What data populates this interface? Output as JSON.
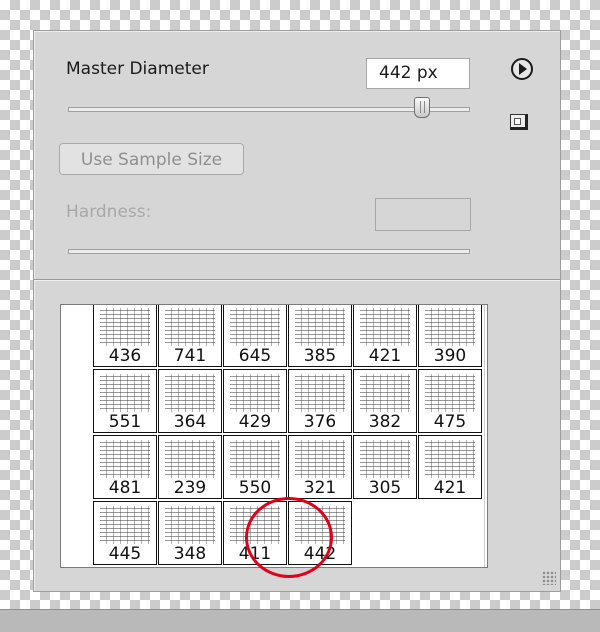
{
  "panel": {
    "master_diameter_label": "Master Diameter",
    "master_diameter_value": "442 px",
    "master_diameter_slider_fraction": 0.88,
    "use_sample_size_label": "Use Sample Size",
    "hardness_label": "Hardness:",
    "hardness_value": ""
  },
  "icons": {
    "menu": "play-circle-icon",
    "new_preset": "new-preset-icon",
    "scroll_up": "triangle-up-icon",
    "scroll_down": "triangle-down-icon",
    "resize": "resize-grip-icon"
  },
  "presets": [
    [
      "436",
      "741",
      "645",
      "385",
      "421",
      "390"
    ],
    [
      "551",
      "364",
      "429",
      "376",
      "382",
      "475"
    ],
    [
      "481",
      "239",
      "550",
      "321",
      "305",
      "421"
    ],
    [
      "445",
      "348",
      "411",
      "442"
    ]
  ],
  "selected_preset": "442",
  "colors": {
    "panel_bg": "#d6d6d6",
    "highlight": "#e0001a"
  }
}
